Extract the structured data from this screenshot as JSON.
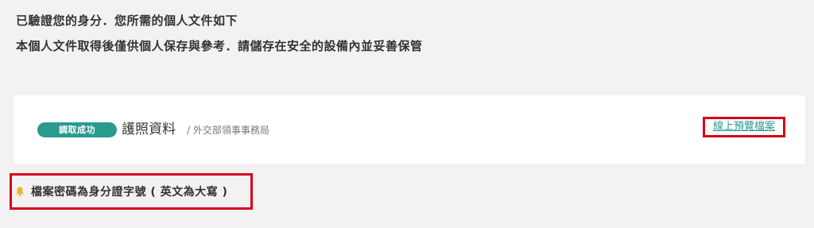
{
  "intro": {
    "line1": "已驗證您的身分．您所需的個人文件如下",
    "line2": "本個人文件取得後僅供個人保存與參考．請儲存在安全的設備內並妥善保管"
  },
  "document": {
    "status_badge": "調取成功",
    "title": "護照資料",
    "source": "/ 外交部領事事務局",
    "preview_link": "線上預覽檔案"
  },
  "notice": {
    "icon": "bell-icon",
    "text": "檔案密碼為身分證字號 ( 英文為大寫 )"
  },
  "colors": {
    "accent": "#2a9a8e",
    "highlight_border": "#d6001c",
    "bell": "#f0b429",
    "page_background": "#f2f2f2",
    "card_background": "#ffffff"
  }
}
